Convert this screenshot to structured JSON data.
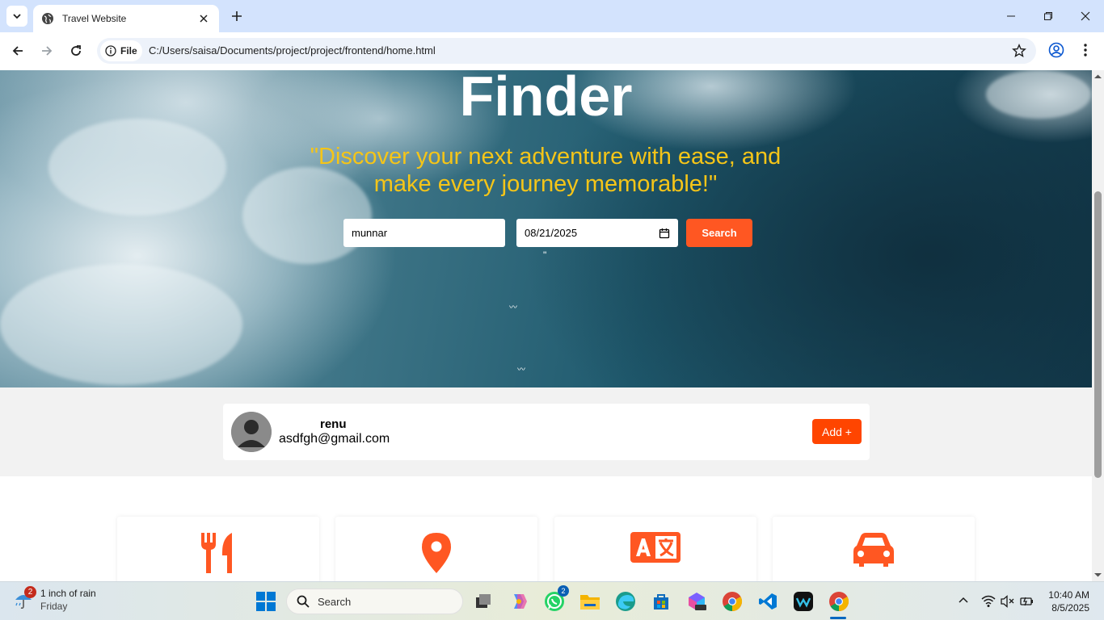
{
  "browser": {
    "tab_title": "Travel Website",
    "address_chip": "File",
    "url": "C:/Users/saisa/Documents/project/project/frontend/home.html"
  },
  "hero": {
    "title": "Finder",
    "tagline": "\"Discover your next adventure with ease, and make every journey memorable!\"",
    "search_value": "munnar",
    "date_value": "08/21/2025",
    "search_button": "Search",
    "stray_text": "\""
  },
  "profile": {
    "name": "renu",
    "email": "asdfgh@gmail.com",
    "add_button": "Add +"
  },
  "features": [
    {
      "icon": "utensils-icon"
    },
    {
      "icon": "location-pin-icon"
    },
    {
      "icon": "translate-icon"
    },
    {
      "icon": "car-icon"
    }
  ],
  "taskbar": {
    "weather_badge": "2",
    "weather_title": "1 inch of rain",
    "weather_day": "Friday",
    "search_label": "Search",
    "whatsapp_badge": "2",
    "time": "10:40 AM",
    "date": "8/5/2025"
  },
  "colors": {
    "accent": "#ff5722",
    "tagline": "#f5c518",
    "add_button": "#ff4500"
  }
}
